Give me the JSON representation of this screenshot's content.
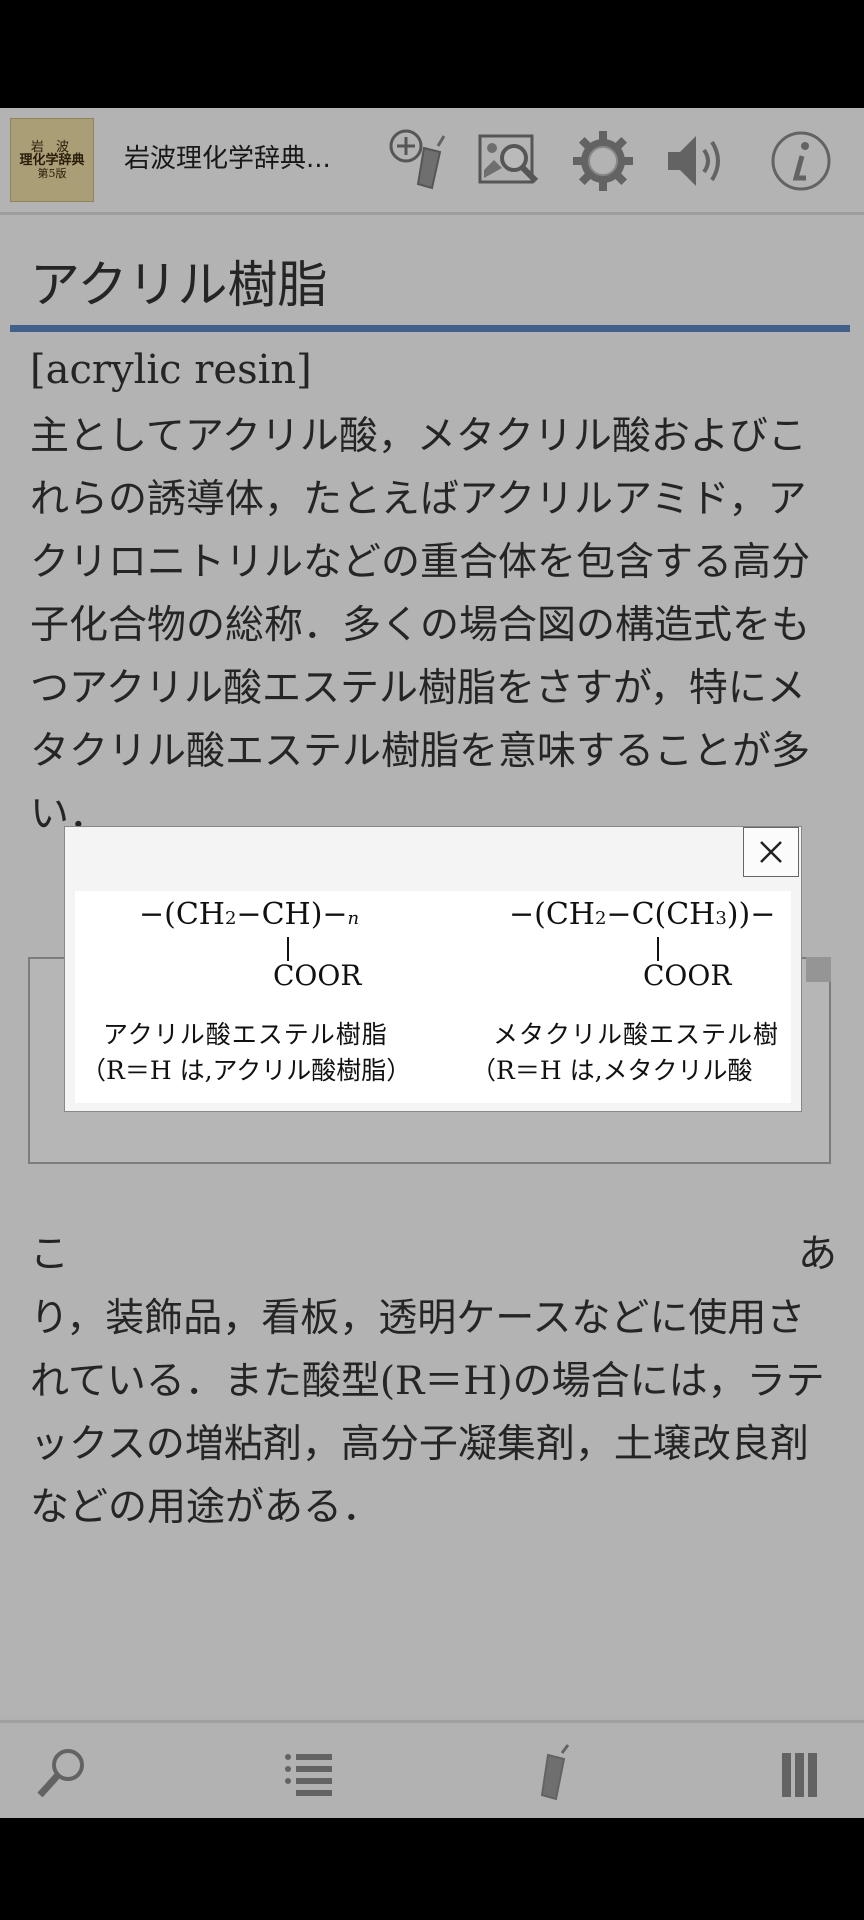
{
  "toolbar": {
    "book_cover": {
      "line1": "岩 波",
      "line2": "理化学辞典",
      "line3": "第5版"
    },
    "title": "岩波理化学辞典...",
    "icons": [
      "add-bookmark-icon",
      "image-search-icon",
      "gear-icon",
      "speaker-icon",
      "info-icon"
    ]
  },
  "entry": {
    "headword": "アクリル樹脂",
    "english": "[acrylic resin]",
    "body_before": "主としてアクリル酸，メタクリル酸およびこれらの誘導体，たとえばアクリルアミド，アクリロニトリルなどの重合体を包含する高分子化合物の総称．多くの場合図の構造式をもつアクリル酸エステル樹脂をさすが，特にメタクリル酸エステル樹脂を意味することが多い．",
    "body_after_first": "こ",
    "body_after_first_end": "あ",
    "body_after": "り，装飾品，看板，透明ケースなどに使用されている．また酸型(R＝H)の場合には，ラテックスの増粘剤，高分子凝集剤，土壌改良剤などの用途がある．"
  },
  "popup": {
    "close_icon": "close-icon",
    "figure": {
      "left_formula": "CH",
      "left_sub": "2",
      "left_formula_rest": "CH",
      "left_n": "n",
      "left_coor": "COOR",
      "left_caption1": "アクリル酸エステル樹脂",
      "left_caption2": "（R＝H は,アクリル酸樹脂）",
      "right_formula": "CH",
      "right_sub": "2",
      "right_formula_rest": "C(CH",
      "right_sub2": "3",
      "right_coor": "COOR",
      "right_caption1": "メタクリル酸エステル樹",
      "right_caption2": "（R＝H は,メタクリル酸"
    }
  },
  "bottom_bar": {
    "icons": [
      "search-icon",
      "list-icon",
      "bookmark-marker-icon",
      "columns-icon"
    ]
  }
}
